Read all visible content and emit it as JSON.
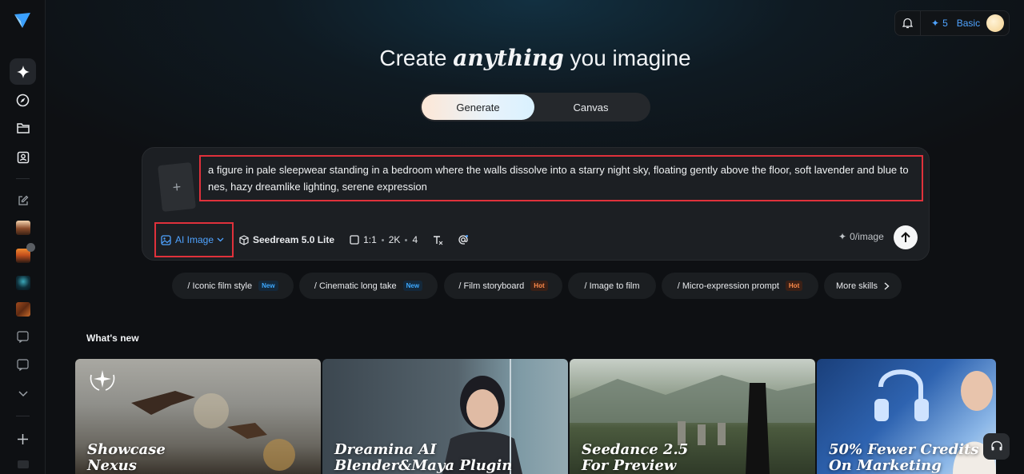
{
  "header": {
    "headline_pre": "Create ",
    "headline_em": "anything",
    "headline_post": " you imagine",
    "credits": "5",
    "plan": "Basic"
  },
  "mode_tabs": [
    "Generate",
    "Canvas"
  ],
  "prompt": {
    "text": "a figure in pale sleepwear standing in a bedroom where the walls dissolve into a starry night sky, floating gently above the floor, soft lavender and blue to nes, hazy dreamlike lighting, serene expression"
  },
  "toolbar": {
    "mode": "AI Image",
    "model": "Seedream 5.0 Lite",
    "ratio": "1:1",
    "resolution": "2K",
    "count": "4",
    "cost": "0/image"
  },
  "skills": [
    {
      "label": "/ Iconic film style",
      "tag": "New"
    },
    {
      "label": "/ Cinematic long take",
      "tag": "New"
    },
    {
      "label": "/ Film storyboard",
      "tag": "Hot"
    },
    {
      "label": "/ Image to film",
      "tag": ""
    },
    {
      "label": "/ Micro-expression prompt",
      "tag": "Hot"
    },
    {
      "label": "More skills",
      "tag": ""
    }
  ],
  "whats_new": {
    "title": "What's new",
    "cards": [
      {
        "line1": "Showcase",
        "line2": "Nexus"
      },
      {
        "line1": "Dreamina AI",
        "line2": "Blender&Maya Plugin"
      },
      {
        "line1": "Seedance 2.5",
        "line2": "For Preview"
      },
      {
        "line1": "50% Fewer Credits",
        "line2": "On Marketing Videos"
      }
    ]
  },
  "colors": {
    "accent": "#4fa3ff",
    "highlight": "#e0313b"
  }
}
